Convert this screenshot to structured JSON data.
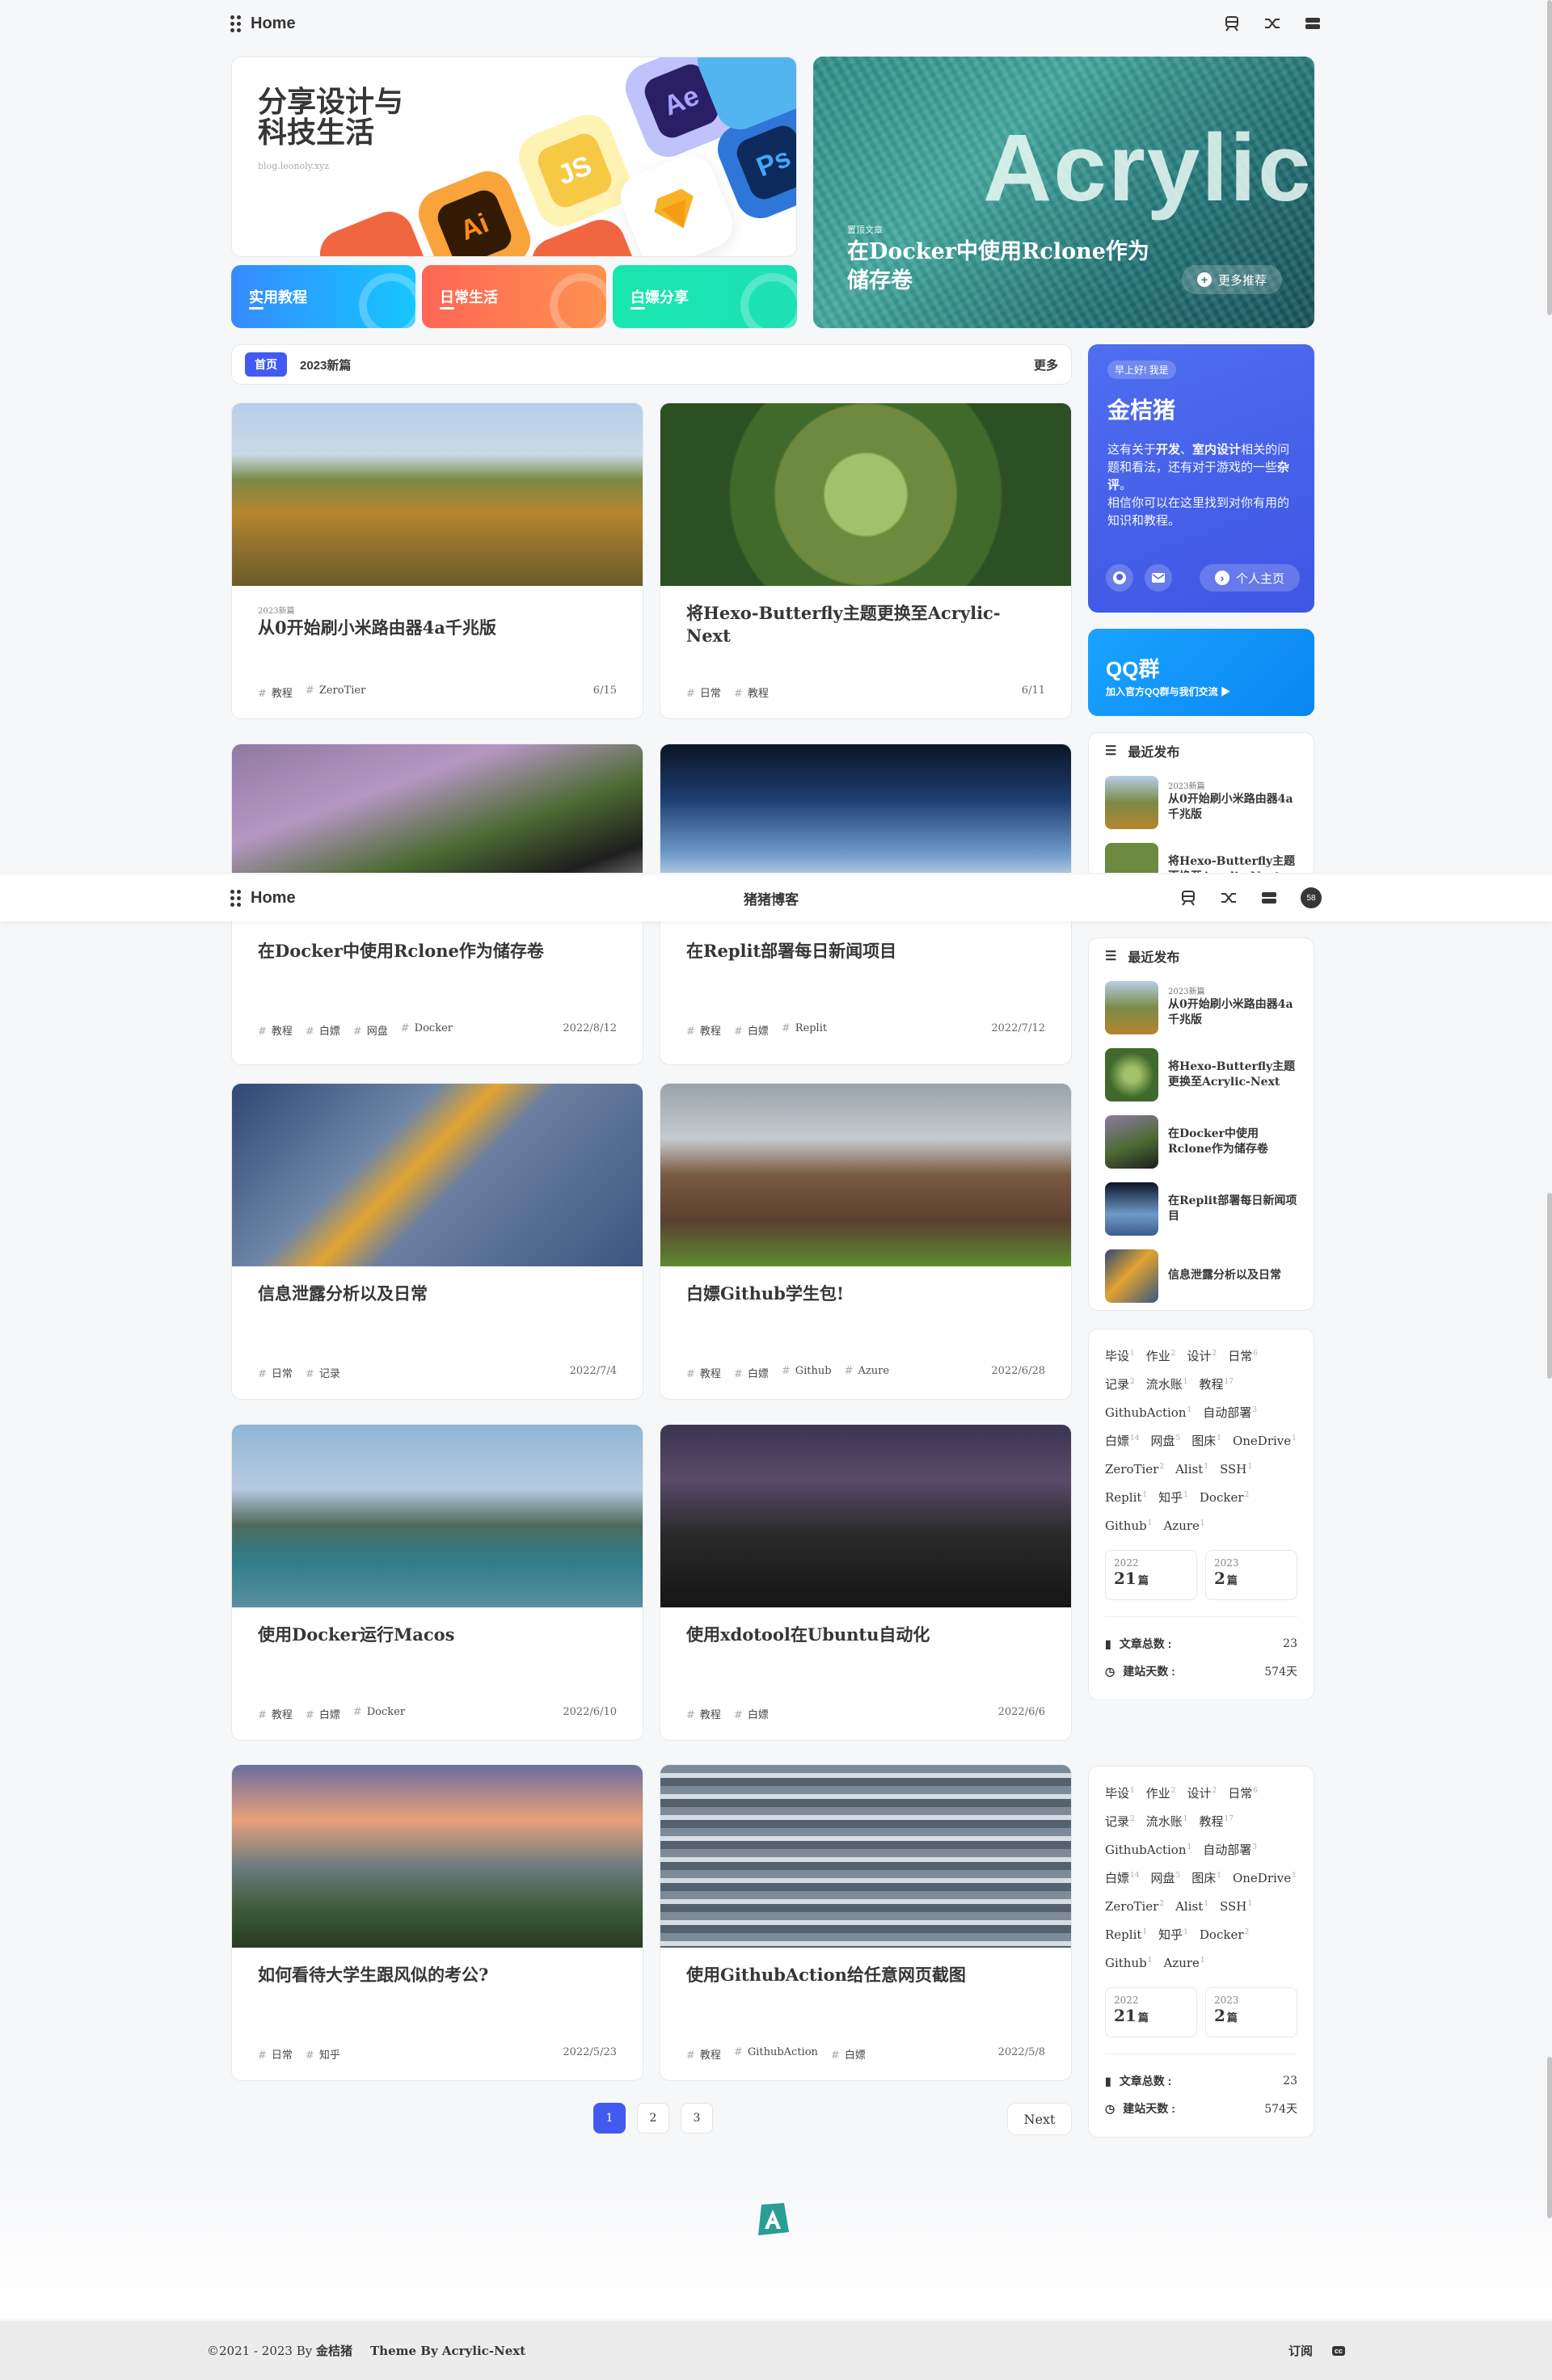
{
  "nav": {
    "home": "Home",
    "blog_name": "猪猪博客",
    "avatar_count": "58"
  },
  "hero": {
    "title": "分享设计与科技生活",
    "url": "blog.leonoly.xyz",
    "apps": [
      "Ae",
      "JS",
      "Ai",
      "Ps"
    ],
    "cat_buttons": [
      "实用教程",
      "日常生活",
      "白嫖分享"
    ],
    "featured_tag": "置顶文章",
    "featured_title": "在Docker中使用Rclone作为储存卷",
    "featured_bg_text": "Acrylic",
    "featured_more": "更多推荐"
  },
  "catbar": {
    "active": "首页",
    "item": "2023新篇",
    "more": "更多"
  },
  "posts": [
    {
      "tag": "2023新篇",
      "title": "从0开始刷小米路由器4a千兆版",
      "tags": [
        "教程",
        "ZeroTier"
      ],
      "date": "6/15"
    },
    {
      "tag": "",
      "title": "将Hexo-Butterfly主题更换至Acrylic-Next",
      "tags": [
        "日常",
        "教程"
      ],
      "date": "6/11"
    },
    {
      "tag": "",
      "title": "在Docker中使用Rclone作为储存卷",
      "tags": [
        "教程",
        "白嫖",
        "网盘",
        "Docker"
      ],
      "date": "2022/8/12"
    },
    {
      "tag": "",
      "title": "在Replit部署每日新闻项目",
      "tags": [
        "教程",
        "白嫖",
        "Replit"
      ],
      "date": "2022/7/12"
    },
    {
      "tag": "",
      "title": "信息泄露分析以及日常",
      "tags": [
        "日常",
        "记录"
      ],
      "date": "2022/7/4"
    },
    {
      "tag": "",
      "title": "白嫖Github学生包!",
      "tags": [
        "教程",
        "白嫖",
        "Github",
        "Azure"
      ],
      "date": "2022/6/28"
    },
    {
      "tag": "",
      "title": "使用Docker运行Macos",
      "tags": [
        "教程",
        "白嫖",
        "Docker"
      ],
      "date": "2022/6/10"
    },
    {
      "tag": "",
      "title": "使用xdotool在Ubuntu自动化",
      "tags": [
        "教程",
        "白嫖"
      ],
      "date": "2022/6/6"
    },
    {
      "tag": "",
      "title": "如何看待大学生跟风似的考公?",
      "tags": [
        "日常",
        "知乎"
      ],
      "date": "2022/5/23"
    },
    {
      "tag": "",
      "title": "使用GithubAction给任意网页截图",
      "tags": [
        "教程",
        "GithubAction",
        "白嫖"
      ],
      "date": "2022/5/8"
    }
  ],
  "author": {
    "greeting": "早上好! 我是",
    "name": "金桔猪",
    "desc_a": "这有关于",
    "desc_b": "开发",
    "desc_c": "、",
    "desc_d": "室内设计",
    "desc_e": "相关的问题和看法，还有对于游戏的一些",
    "desc_f": "杂评",
    "desc_g": "。",
    "desc_h": "相信你可以在这里找到对你有用的知识和教程。",
    "home_btn": "个人主页"
  },
  "qq": {
    "title": "QQ群",
    "sub": "加入官方QQ群与我们交流 ▶"
  },
  "recent": {
    "title": "最近发布",
    "items": [
      {
        "tag": "2023新篇",
        "title": "从0开始刷小米路由器4a千兆版"
      },
      {
        "tag": "",
        "title": "将Hexo-Butterfly主题更换至Acrylic-Next"
      },
      {
        "tag": "",
        "title": "在Docker中使用Rclone作为储存卷"
      },
      {
        "tag": "",
        "title": "在Replit部署每日新闻项目"
      },
      {
        "tag": "",
        "title": "信息泄露分析以及日常"
      }
    ]
  },
  "tagcloud": {
    "tags": [
      [
        "毕设",
        "1"
      ],
      [
        "作业",
        "2"
      ],
      [
        "设计",
        "2"
      ],
      [
        "日常",
        "6"
      ],
      [
        "记录",
        "2"
      ],
      [
        "流水账",
        "1"
      ],
      [
        "教程",
        "17"
      ],
      [
        "GithubAction",
        "1"
      ],
      [
        "自动部署",
        "3"
      ],
      [
        "白嫖",
        "14"
      ],
      [
        "网盘",
        "5"
      ],
      [
        "图床",
        "1"
      ],
      [
        "OneDrive",
        "1"
      ],
      [
        "ZeroTier",
        "2"
      ],
      [
        "Alist",
        "1"
      ],
      [
        "SSH",
        "1"
      ],
      [
        "Replit",
        "1"
      ],
      [
        "知乎",
        "1"
      ],
      [
        "Docker",
        "2"
      ],
      [
        "Github",
        "1"
      ],
      [
        "Azure",
        "1"
      ]
    ],
    "years": [
      {
        "y": "2022",
        "n": "21",
        "u": "篇"
      },
      {
        "y": "2023",
        "n": "2",
        "u": "篇"
      }
    ],
    "stat1_label": "文章总数 :",
    "stat1_value": "23",
    "stat2_label": "建站天数 :",
    "stat2_value": "574天"
  },
  "pagination": {
    "pages": [
      "1",
      "2",
      "3"
    ],
    "next": "Next"
  },
  "footer": {
    "copy": "©2021 - 2023 By ",
    "author": "金桔猪",
    "theme": "Theme By Acrylic-Next",
    "rss": "订阅",
    "cc": "cc"
  },
  "colors": {
    "accent": "#425aef",
    "qq": "#1aa3ff"
  }
}
